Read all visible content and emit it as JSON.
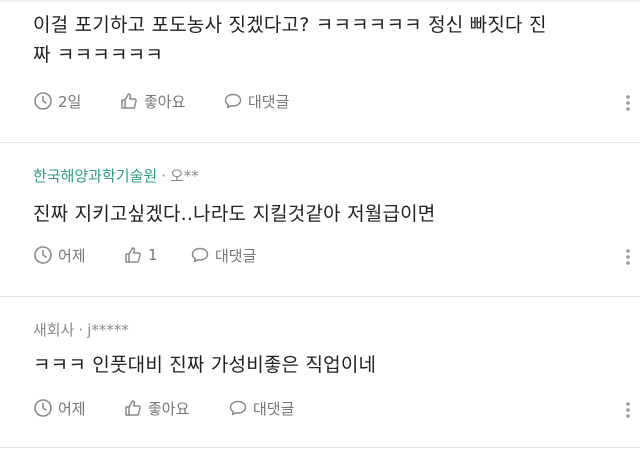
{
  "comments": [
    {
      "company": "",
      "author": "",
      "text_line1": "이걸 포기하고 포도농사 짓겠다고? ㅋㅋㅋㅋㅋㅋ 정신 빠짓다 진",
      "text_line2": "짜 ㅋㅋㅋㅋㅋㅋ",
      "time": "2일",
      "like_label": "좋아요",
      "reply_label": "대댓글"
    },
    {
      "company": "한국해양과학기술원",
      "author": "오**",
      "text_line1": "진짜 지키고싶겠다..나라도 지킬것같아 저월급이면",
      "time": "어제",
      "like_label": "1",
      "reply_label": "대댓글"
    },
    {
      "company": "새회사",
      "author": "j*****",
      "text_line1": "ㅋㅋㅋ 인풋대비 진짜 가성비좋은 직업이네",
      "time": "어제",
      "like_label": "좋아요",
      "reply_label": "대댓글"
    }
  ],
  "icons": {
    "clock": "clock-icon",
    "like": "thumbs-up-icon",
    "reply": "speech-bubble-icon",
    "more": "more-vertical-icon"
  },
  "colors": {
    "accent_company": "#2f9d8a",
    "meta_text": "#8a8a8a",
    "divider": "#e3e3e3"
  }
}
